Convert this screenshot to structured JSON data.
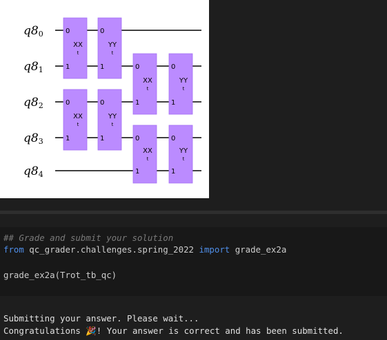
{
  "circuit": {
    "register": "q8",
    "qubits": [
      {
        "label": "q8",
        "index": "0"
      },
      {
        "label": "q8",
        "index": "1"
      },
      {
        "label": "q8",
        "index": "2"
      },
      {
        "label": "q8",
        "index": "3"
      },
      {
        "label": "q8",
        "index": "4"
      }
    ],
    "gates": [
      {
        "name": "XX",
        "param": "t",
        "qubits": [
          0,
          1
        ],
        "column": 0
      },
      {
        "name": "YY",
        "param": "t",
        "qubits": [
          0,
          1
        ],
        "column": 1
      },
      {
        "name": "XX",
        "param": "t",
        "qubits": [
          2,
          3
        ],
        "column": 0
      },
      {
        "name": "YY",
        "param": "t",
        "qubits": [
          2,
          3
        ],
        "column": 1
      },
      {
        "name": "XX",
        "param": "t",
        "qubits": [
          1,
          2
        ],
        "column": 2
      },
      {
        "name": "YY",
        "param": "t",
        "qubits": [
          1,
          2
        ],
        "column": 3
      },
      {
        "name": "XX",
        "param": "t",
        "qubits": [
          3,
          4
        ],
        "column": 2
      },
      {
        "name": "YY",
        "param": "t",
        "qubits": [
          3,
          4
        ],
        "column": 3
      }
    ],
    "port_labels": [
      "0",
      "1"
    ],
    "colors": {
      "gate_fill": "#bb8bff",
      "wire": "#000000",
      "background": "#ffffff"
    }
  },
  "code": {
    "comment": "## Grade and submit your solution",
    "from_kw": "from",
    "module": " qc_grader.challenges.spring_2022 ",
    "import_kw": "import",
    "imported": " grade_ex2a",
    "call": "grade_ex2a(Trot_tb_qc)"
  },
  "output": {
    "line1": "Submitting your answer. Please wait...",
    "line2_prefix": "Congratulations ",
    "emoji": "🎉",
    "line2_suffix": "! Your answer is correct and has been submitted."
  },
  "theme": {
    "cell_bg": "#181818",
    "notebook_bg": "#1e1e1e",
    "keyword": "#4f8ee8",
    "comment": "#7a7a7a"
  }
}
